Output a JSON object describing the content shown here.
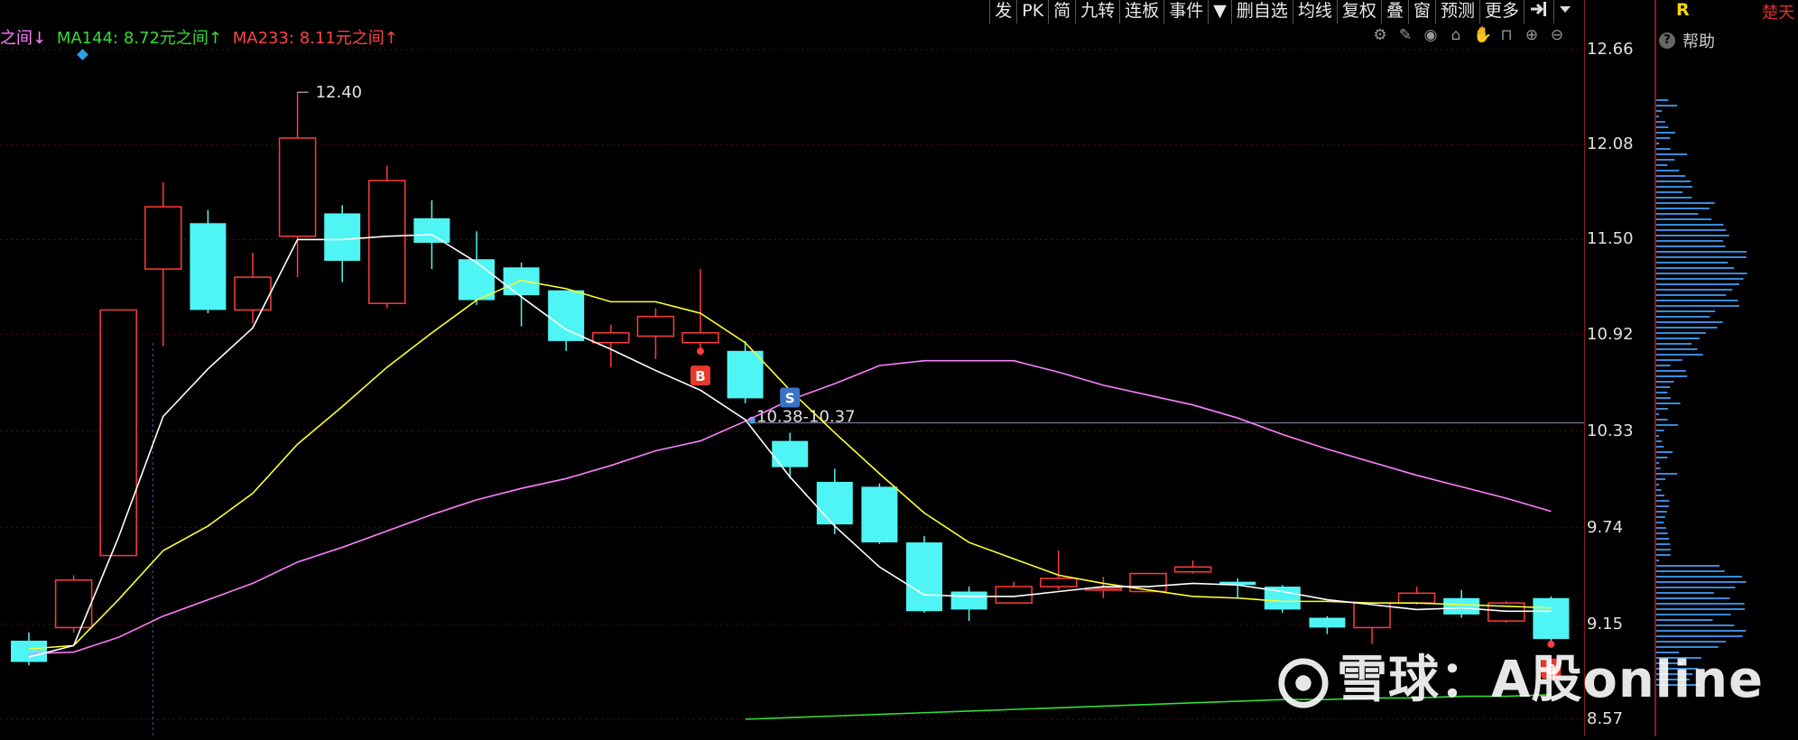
{
  "toolbar": {
    "items": [
      "发",
      "PK",
      "简",
      "九转",
      "连板",
      "事件",
      "▼",
      "删自选",
      "均线",
      "复权",
      "叠",
      "窗",
      "预测",
      "更多"
    ],
    "exit_icon": "exit-fullscreen-icon",
    "dropdown_icon": "caret-down-icon"
  },
  "legend": {
    "prefix": "之间↓",
    "ma144": "MA144: 8.72元之间↑",
    "ma233": "MA233: 8.11元之间↑"
  },
  "price_axis": {
    "labels": [
      "12.66",
      "12.08",
      "11.50",
      "10.92",
      "10.33",
      "9.74",
      "9.15",
      "8.57"
    ]
  },
  "right_panel": {
    "r_label": "R",
    "stock_name": "楚天",
    "help_label": "帮助"
  },
  "annotations": {
    "high_label": "12.40",
    "range_label": "10.38-10.37",
    "buy_marker": "B",
    "sell_marker": "S"
  },
  "watermark": {
    "text": "雪球：A股online"
  },
  "colors": {
    "up": "#ff3b3b",
    "down": "#4ff5f5",
    "ma5": "#ffffff",
    "ma10": "#ffff33",
    "ma20": "#ff7fff",
    "ma144": "#33dd33",
    "ma233": "#ff4444"
  },
  "chart_data": {
    "type": "candlestick",
    "ylim": [
      8.57,
      12.66
    ],
    "y_ticks": [
      12.66,
      12.08,
      11.5,
      10.92,
      10.33,
      9.74,
      9.15,
      8.57
    ],
    "candles": [
      {
        "o": 9.05,
        "c": 8.92,
        "h": 9.1,
        "l": 8.9
      },
      {
        "o": 9.13,
        "c": 9.42,
        "h": 9.45,
        "l": 9.1
      },
      {
        "o": 9.57,
        "c": 11.07,
        "h": 11.07,
        "l": 9.57
      },
      {
        "o": 11.32,
        "c": 11.7,
        "h": 11.85,
        "l": 10.85
      },
      {
        "o": 11.6,
        "c": 11.07,
        "h": 11.68,
        "l": 11.05
      },
      {
        "o": 11.07,
        "c": 11.27,
        "h": 11.42,
        "l": 10.99
      },
      {
        "o": 11.52,
        "c": 12.12,
        "h": 12.4,
        "l": 11.27
      },
      {
        "o": 11.66,
        "c": 11.37,
        "h": 11.71,
        "l": 11.24
      },
      {
        "o": 11.11,
        "c": 11.86,
        "h": 11.95,
        "l": 11.08
      },
      {
        "o": 11.63,
        "c": 11.48,
        "h": 11.74,
        "l": 11.32
      },
      {
        "o": 11.38,
        "c": 11.13,
        "h": 11.55,
        "l": 11.1
      },
      {
        "o": 11.33,
        "c": 11.16,
        "h": 11.36,
        "l": 10.97
      },
      {
        "o": 11.19,
        "c": 10.88,
        "h": 11.19,
        "l": 10.82
      },
      {
        "o": 10.87,
        "c": 10.93,
        "h": 10.98,
        "l": 10.72
      },
      {
        "o": 10.91,
        "c": 11.03,
        "h": 11.08,
        "l": 10.77
      },
      {
        "o": 10.87,
        "c": 10.93,
        "h": 11.32,
        "l": 10.84
      },
      {
        "o": 10.82,
        "c": 10.53,
        "h": 10.88,
        "l": 10.5
      },
      {
        "o": 10.27,
        "c": 10.11,
        "h": 10.32,
        "l": 10.04
      },
      {
        "o": 10.02,
        "c": 9.76,
        "h": 10.1,
        "l": 9.7
      },
      {
        "o": 9.99,
        "c": 9.65,
        "h": 10.01,
        "l": 9.64
      },
      {
        "o": 9.65,
        "c": 9.23,
        "h": 9.69,
        "l": 9.22
      },
      {
        "o": 9.35,
        "c": 9.24,
        "h": 9.38,
        "l": 9.17
      },
      {
        "o": 9.28,
        "c": 9.38,
        "h": 9.41,
        "l": 9.28
      },
      {
        "o": 9.38,
        "c": 9.43,
        "h": 9.6,
        "l": 9.36
      },
      {
        "o": 9.36,
        "c": 9.37,
        "h": 9.44,
        "l": 9.31
      },
      {
        "o": 9.35,
        "c": 9.46,
        "h": 9.46,
        "l": 9.35
      },
      {
        "o": 9.47,
        "c": 9.5,
        "h": 9.54,
        "l": 9.46
      },
      {
        "o": 9.41,
        "c": 9.39,
        "h": 9.43,
        "l": 9.31
      },
      {
        "o": 9.38,
        "c": 9.24,
        "h": 9.39,
        "l": 9.22
      },
      {
        "o": 9.19,
        "c": 9.13,
        "h": 9.2,
        "l": 9.09
      },
      {
        "o": 9.13,
        "c": 9.28,
        "h": 9.28,
        "l": 9.03
      },
      {
        "o": 9.28,
        "c": 9.34,
        "h": 9.38,
        "l": 9.27
      },
      {
        "o": 9.31,
        "c": 9.21,
        "h": 9.36,
        "l": 9.19
      },
      {
        "o": 9.17,
        "c": 9.28,
        "h": 9.29,
        "l": 9.16
      },
      {
        "o": 9.31,
        "c": 9.06,
        "h": 9.32,
        "l": 9.05
      }
    ],
    "ma5": [
      8.95,
      9.02,
      9.68,
      10.42,
      10.71,
      10.96,
      11.5,
      11.5,
      11.52,
      11.53,
      11.36,
      11.15,
      10.95,
      10.83,
      10.7,
      10.58,
      10.4,
      10.05,
      9.75,
      9.5,
      9.33,
      9.32,
      9.32,
      9.35,
      9.38,
      9.38,
      9.4,
      9.39,
      9.35,
      9.3,
      9.27,
      9.24,
      9.25,
      9.23,
      9.23
    ],
    "ma10": [
      9.0,
      9.02,
      9.3,
      9.6,
      9.75,
      9.95,
      10.25,
      10.48,
      10.72,
      10.93,
      11.13,
      11.25,
      11.2,
      11.12,
      11.12,
      11.05,
      10.87,
      10.58,
      10.32,
      10.07,
      9.83,
      9.65,
      9.55,
      9.45,
      9.4,
      9.36,
      9.32,
      9.31,
      9.29,
      9.29,
      9.28,
      9.28,
      9.27,
      9.26,
      9.25
    ],
    "ma20": [
      8.97,
      8.98,
      9.07,
      9.2,
      9.3,
      9.4,
      9.53,
      9.62,
      9.72,
      9.82,
      9.91,
      9.98,
      10.04,
      10.12,
      10.21,
      10.27,
      10.39,
      10.52,
      10.62,
      10.73,
      10.76,
      10.76,
      10.76,
      10.69,
      10.61,
      10.55,
      10.49,
      10.41,
      10.31,
      10.22,
      10.14,
      10.06,
      9.99,
      9.92,
      9.84
    ],
    "ma144": [
      null,
      null,
      null,
      null,
      null,
      null,
      null,
      null,
      null,
      null,
      null,
      null,
      null,
      null,
      null,
      null,
      8.57,
      8.58,
      8.59,
      8.6,
      8.61,
      8.62,
      8.63,
      8.64,
      8.65,
      8.66,
      8.67,
      8.68,
      8.69,
      8.69,
      8.7,
      8.7,
      8.71,
      8.71,
      8.72
    ],
    "reference_price": 10.38,
    "high_price": 12.4,
    "markers": [
      {
        "type": "buy",
        "index": 15
      },
      {
        "type": "sell",
        "index": 17
      },
      {
        "type": "buy",
        "index": 34
      }
    ]
  }
}
